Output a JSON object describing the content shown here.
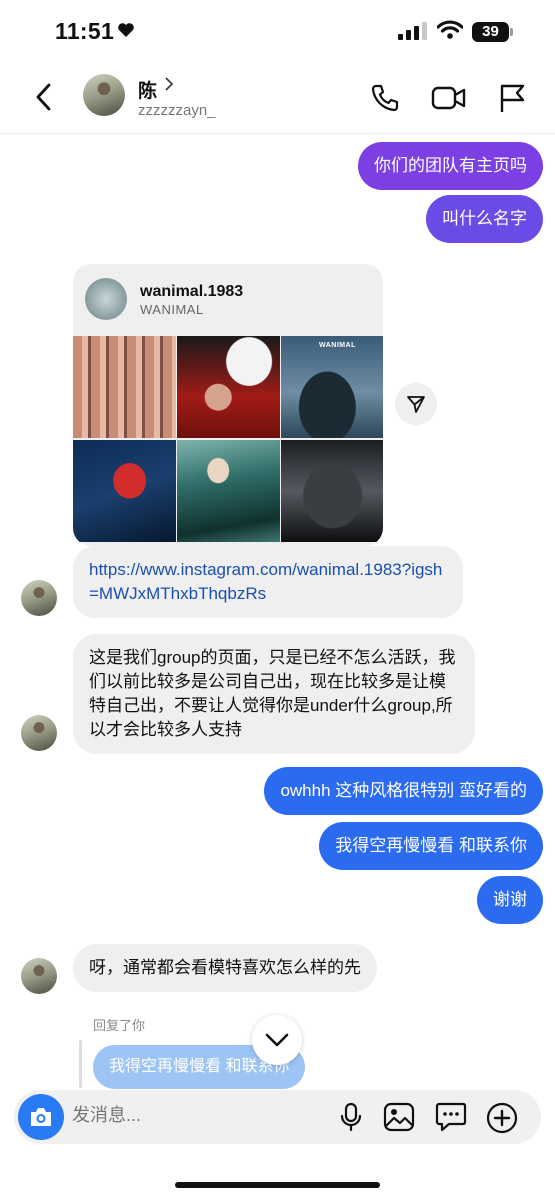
{
  "status_bar": {
    "time": "11:51",
    "battery": "39"
  },
  "header": {
    "contact_name": "陈",
    "username": "zzzzzzayn_"
  },
  "messages": {
    "sent_1": "你们的团队有主页吗",
    "sent_2": "叫什么名字",
    "shared_post": {
      "username": "wanimal.1983",
      "subtitle": "WANIMAL",
      "image_tag": "WANIMAL"
    },
    "link": "https://www.instagram.com/wanimal.1983?igsh=MWJxMThxbThqbzRs",
    "received_1": "这是我们group的页面，只是已经不怎么活跃，我们以前比较多是公司自己出，现在比较多是让模特自己出，不要让人觉得你是under什么group,所以才会比较多人支持",
    "sent_3": "owhhh 这种风格很特别 蛮好看的",
    "sent_4": "我得空再慢慢看 和联系你",
    "sent_5": "谢谢",
    "received_2": "呀，通常都会看模特喜欢怎么样的先",
    "reply_label": "回复了你",
    "reply_quote": "我得空再慢慢看 和联系你"
  },
  "composer": {
    "placeholder": "发消息..."
  },
  "icons": [
    "heart-icon",
    "signal-icon",
    "wifi-icon",
    "back-icon",
    "chevron-right-icon",
    "phone-icon",
    "video-icon",
    "flag-icon",
    "share-icon",
    "chevron-down-icon",
    "camera-icon",
    "microphone-icon",
    "gallery-icon",
    "sticker-icon",
    "add-icon"
  ],
  "colors": {
    "sent_purple": "#7b3fe4",
    "sent_blue": "#2b6bf0",
    "received_gray": "#efefef",
    "camera_blue": "#2a7af5"
  }
}
